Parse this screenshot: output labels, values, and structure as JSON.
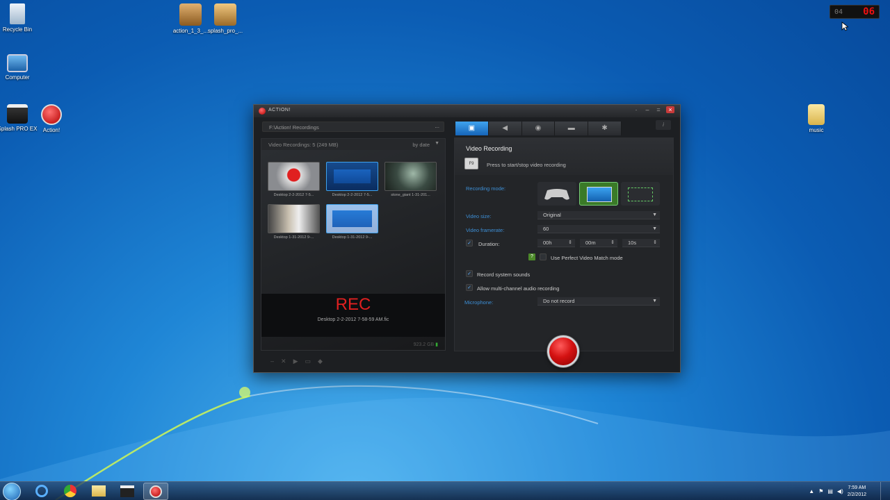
{
  "desktop": {
    "icons": [
      {
        "label": "Recycle Bin"
      },
      {
        "label": "Computer"
      },
      {
        "label": "Splash PRO EX"
      },
      {
        "label": "Action!"
      },
      {
        "label": "action_1_3_..."
      },
      {
        "label": "splash_pro_..."
      },
      {
        "label": "music"
      }
    ]
  },
  "fps_widget": {
    "left": "04",
    "right": "06"
  },
  "window": {
    "title": "ACTION!",
    "path": "F:\\Action! Recordings",
    "path_button": "...",
    "list_header": "Video Recordings: 5 (249 MB)",
    "sort_label": "by date",
    "recordings": [
      {
        "label": "Desktop 2-2-2012 7-5..."
      },
      {
        "label": "Desktop 2-2-2012 7-5..."
      },
      {
        "label": "stone_giant 1-31-201..."
      },
      {
        "label": "Desktop 1-31-2012 9-..."
      },
      {
        "label": "Desktop 1-31-2012 9-..."
      }
    ],
    "rec_status": "REC",
    "rec_file": "Desktop 2-2-2012 7-58-59 AM.fic",
    "disk_free": "923.2 GB",
    "tabs": [
      "video",
      "audio",
      "benchmark",
      "screenshot",
      "settings"
    ],
    "info_button": "i",
    "settings": {
      "title": "Video Recording",
      "hotkey": "F9",
      "hint": "Press to start/stop video recording",
      "recording_mode_label": "Recording mode:",
      "video_size_label": "Video size:",
      "video_size_value": "Original",
      "video_framerate_label": "Video framerate:",
      "video_framerate_value": "60",
      "duration_label": "Duration:",
      "duration_h": "00h",
      "duration_m": "00m",
      "duration_s": "10s",
      "perfect_match_label": "Use Perfect Video Match mode",
      "help_glyph": "?",
      "record_sounds_label": "Record system sounds",
      "multichannel_label": "Allow multi-channel audio recording",
      "microphone_label": "Microphone:",
      "microphone_value": "Do not record"
    }
  },
  "taskbar": {
    "time": "7:59 AM",
    "date": "2/2/2012"
  }
}
